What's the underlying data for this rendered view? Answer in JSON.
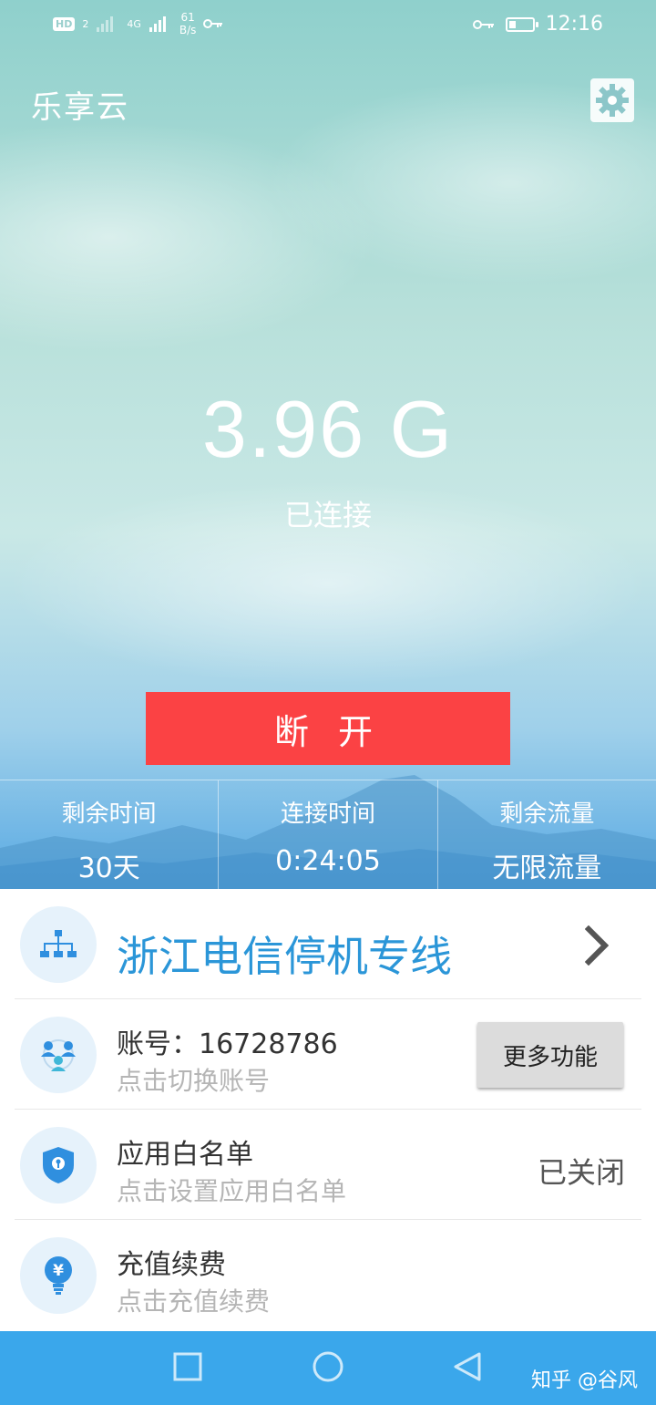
{
  "status_bar": {
    "hd_label": "HD",
    "sim": "2",
    "network": "4G",
    "speed_value": "61",
    "speed_unit": "B/s",
    "battery_level": 0.3,
    "time": "12:16"
  },
  "app": {
    "title": "乐享云"
  },
  "hero": {
    "data_amount": "3.96 G",
    "connection_status": "已连接",
    "disconnect_label": "断 开"
  },
  "stats": [
    {
      "label": "剩余时间",
      "value": "30天"
    },
    {
      "label": "连接时间",
      "value": "0:24:05"
    },
    {
      "label": "剩余流量",
      "value": "无限流量"
    }
  ],
  "line": {
    "title": "浙江电信停机专线"
  },
  "account": {
    "title": "账号：16728786",
    "subtitle": "点击切换账号",
    "more_label": "更多功能"
  },
  "whitelist": {
    "title": "应用白名单",
    "subtitle": "点击设置应用白名单",
    "state": "已关闭"
  },
  "recharge": {
    "title": "充值续费",
    "subtitle": "点击充值续费",
    "currency_symbol": "¥"
  },
  "watermark": "知乎 @谷风",
  "colors": {
    "accent_blue": "#2b96d8",
    "disconnect_red": "#fb4244",
    "nav_blue": "#3aa7eb",
    "icon_blue": "#2f8fdf"
  }
}
